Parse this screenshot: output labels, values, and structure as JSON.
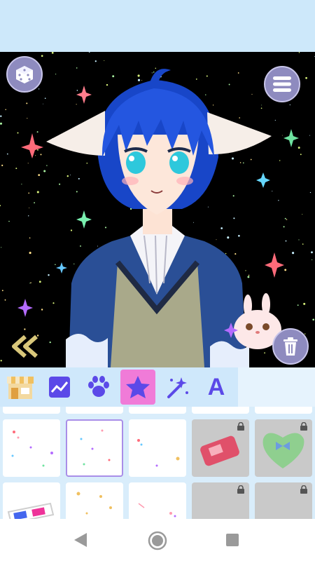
{
  "toolbar": {
    "dice_icon": "dice-icon",
    "menu_icon": "list-menu-icon",
    "trash_icon": "trash-icon",
    "back_icon": "double-chevron-left-icon"
  },
  "tabs": [
    {
      "id": "shop",
      "icon": "shop-icon"
    },
    {
      "id": "background",
      "icon": "landscape-icon"
    },
    {
      "id": "pets",
      "icon": "paw-icon"
    },
    {
      "id": "effects",
      "icon": "star-icon",
      "active": true
    },
    {
      "id": "magic",
      "icon": "magic-wand-icon"
    },
    {
      "id": "text",
      "icon": "text-icon",
      "label": "A"
    }
  ],
  "items": [
    {
      "kind": "sparkle-effect",
      "locked": false
    },
    {
      "kind": "sparkle-effect",
      "locked": false,
      "selected": true
    },
    {
      "kind": "sparkle-effect",
      "locked": false
    },
    {
      "kind": "game-console",
      "locked": true
    },
    {
      "kind": "heart-box",
      "locked": true
    },
    {
      "kind": "3d-glasses",
      "locked": false
    },
    {
      "kind": "sparkle-effect",
      "locked": false
    },
    {
      "kind": "sparkle-effect",
      "locked": false
    },
    {
      "kind": "item",
      "locked": true
    },
    {
      "kind": "item",
      "locked": true
    }
  ],
  "colors": {
    "accent": "#f07bd8",
    "icon": "#5b49e8",
    "top_bar": "#cde8fa",
    "button": "#8e8bbf"
  }
}
